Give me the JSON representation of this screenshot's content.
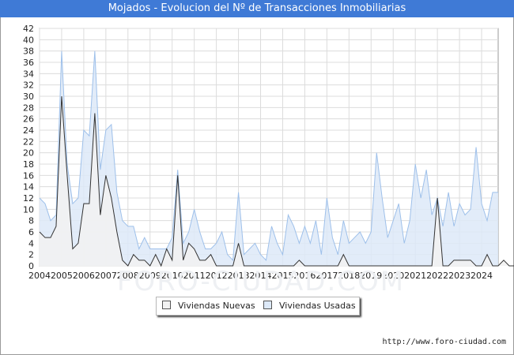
{
  "title": "Mojados - Evolucion del Nº de Transacciones Inmobiliarias",
  "source": "http://www.foro-ciudad.com",
  "watermark": "FORO-CIUDAD.COM",
  "colors": {
    "title_bg": "#3f7ad6",
    "nuevas_fill": "#f2f2f2",
    "nuevas_line": "#333333",
    "usadas_fill": "#dde9f8",
    "usadas_line": "#9ec0ea"
  },
  "chart_data": {
    "type": "area",
    "title": "Mojados - Evolucion del Nº de Transacciones Inmobiliarias",
    "xlabel": "",
    "ylabel": "",
    "ylim": [
      0,
      42
    ],
    "yticks": [
      0,
      2,
      4,
      6,
      8,
      10,
      12,
      14,
      16,
      18,
      20,
      22,
      24,
      26,
      28,
      30,
      32,
      34,
      36,
      38,
      40,
      42
    ],
    "xlim": [
      2004,
      2024.75
    ],
    "xticks": [
      "2004",
      "2005",
      "2006",
      "2007",
      "2008",
      "2009",
      "2010",
      "2011",
      "2012",
      "2013",
      "2014",
      "2015",
      "2016",
      "2017",
      "2018",
      "2019",
      "2020",
      "2021",
      "2022",
      "2023",
      "2024"
    ],
    "x_unit": "quarter",
    "grid": true,
    "legend_position": "bottom-center",
    "series": [
      {
        "name": "Viviendas Nuevas",
        "values": [
          6,
          5,
          5,
          7,
          30,
          16,
          3,
          4,
          11,
          11,
          27,
          9,
          16,
          12,
          6,
          1,
          0,
          2,
          1,
          1,
          0,
          2,
          0,
          3,
          1,
          16,
          1,
          4,
          3,
          1,
          1,
          2,
          0,
          0,
          0,
          0,
          4,
          0,
          0,
          0,
          0,
          0,
          0,
          0,
          0,
          0,
          0,
          1,
          0,
          0,
          0,
          0,
          0,
          0,
          0,
          2,
          0,
          0,
          0,
          0,
          0,
          0,
          0,
          0,
          0,
          0,
          0,
          0,
          0,
          0,
          0,
          0,
          12,
          0,
          0,
          1,
          1,
          1,
          1,
          0,
          0,
          2,
          0,
          0,
          1,
          0,
          0,
          0,
          0,
          0,
          0,
          1,
          1,
          0,
          3,
          0,
          0
        ]
      },
      {
        "name": "Viviendas Usadas",
        "values": [
          12,
          11,
          8,
          9,
          38,
          18,
          11,
          12,
          24,
          23,
          38,
          17,
          24,
          25,
          13,
          8,
          7,
          7,
          3,
          5,
          3,
          3,
          3,
          3,
          5,
          17,
          4,
          6,
          10,
          6,
          3,
          3,
          4,
          6,
          2,
          1,
          13,
          2,
          3,
          4,
          2,
          1,
          7,
          4,
          2,
          9,
          7,
          4,
          7,
          4,
          8,
          2,
          12,
          5,
          2,
          8,
          4,
          5,
          6,
          4,
          6,
          20,
          12,
          5,
          8,
          11,
          4,
          8,
          18,
          12,
          17,
          9,
          12,
          7,
          13,
          7,
          11,
          9,
          10,
          21,
          11,
          8,
          13,
          13
        ]
      }
    ]
  },
  "legend": [
    {
      "label": "Viviendas Nuevas"
    },
    {
      "label": "Viviendas Usadas"
    }
  ]
}
